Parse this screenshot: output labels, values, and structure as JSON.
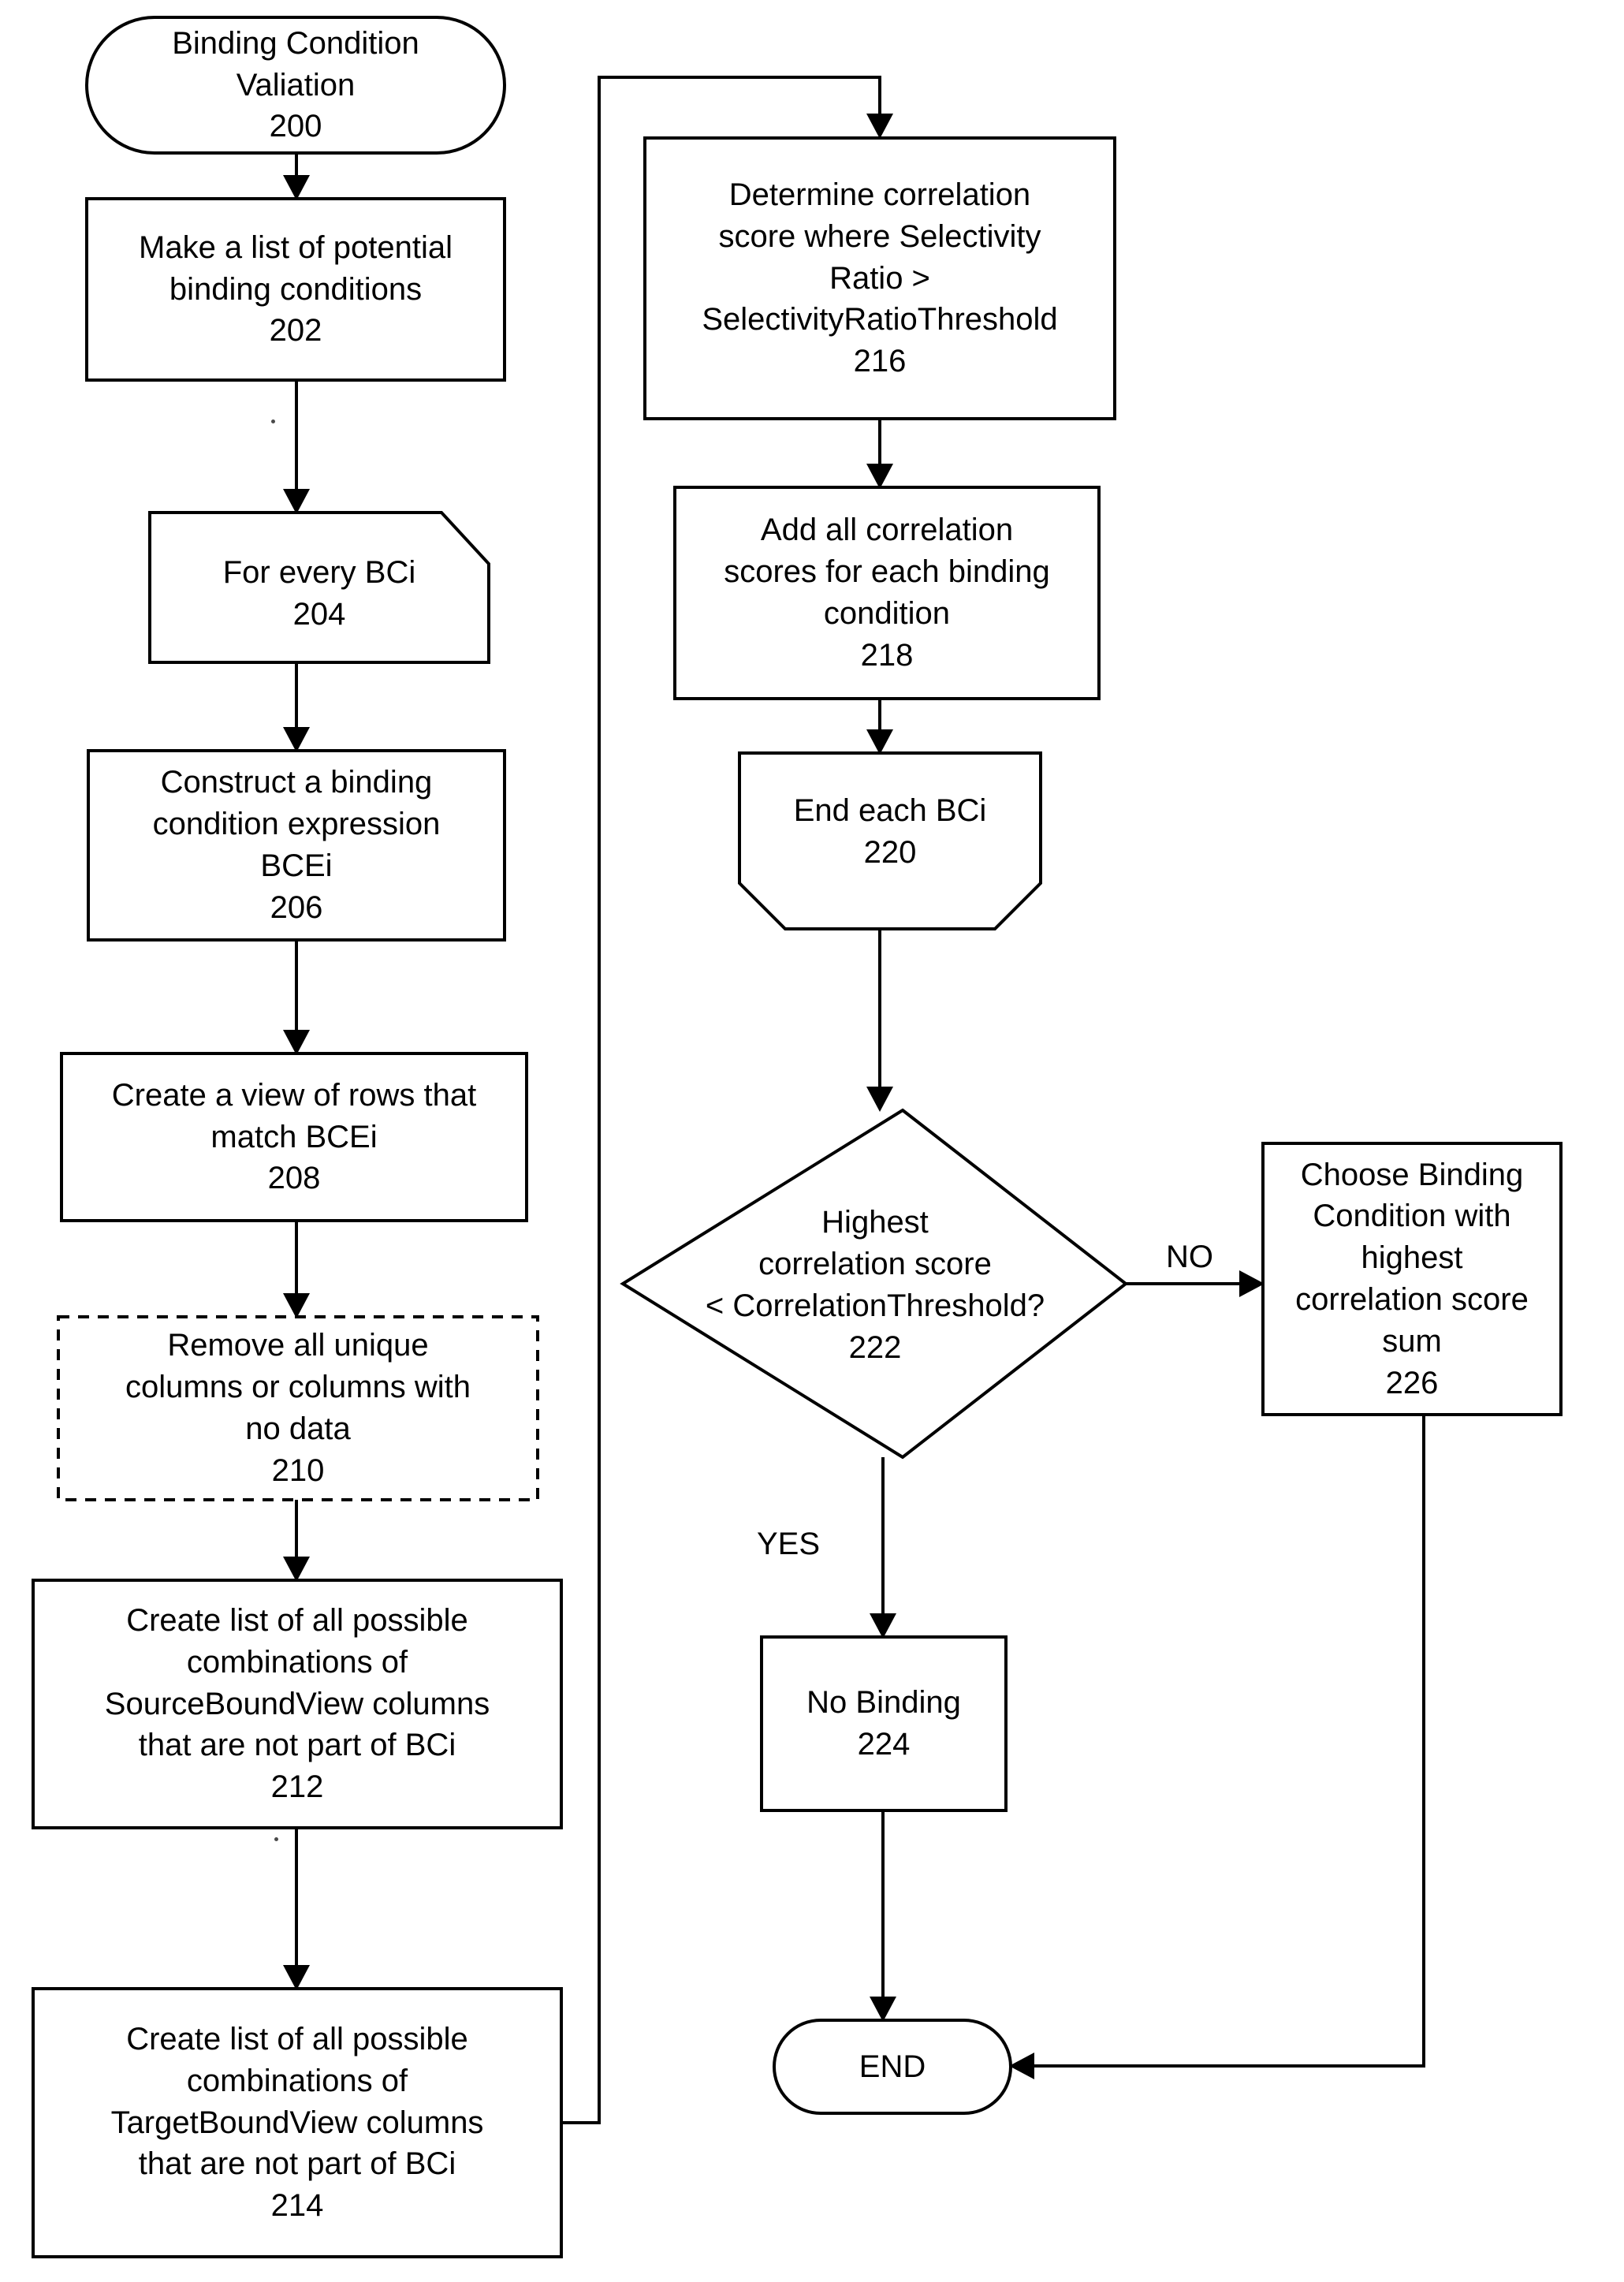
{
  "diagram": {
    "title": "Binding Condition Valiation flowchart",
    "stroke_color": "#000000",
    "fill_color": "#ffffff",
    "background": "#ffffff"
  },
  "nodes": {
    "n200": {
      "label": "Binding Condition\nValiation\n200",
      "ref": "200",
      "shape": "stadium"
    },
    "n202": {
      "label": "Make a list of potential\nbinding conditions\n202",
      "ref": "202",
      "shape": "rect"
    },
    "n204": {
      "label": "For every BCi\n204",
      "ref": "204",
      "shape": "loop-start"
    },
    "n206": {
      "label": "Construct a binding\ncondition expression\nBCEi\n206",
      "ref": "206",
      "shape": "rect"
    },
    "n208": {
      "label": "Create a view of rows that\nmatch  BCEi\n208",
      "ref": "208",
      "shape": "rect"
    },
    "n210": {
      "label": "Remove all unique\ncolumns or columns with\nno data\n210",
      "ref": "210",
      "shape": "rect-dashed"
    },
    "n212": {
      "label": "Create list of all possible\ncombinations of\nSourceBoundView columns\nthat are not part of BCi\n212",
      "ref": "212",
      "shape": "rect"
    },
    "n214": {
      "label": "Create list of all possible\ncombinations of\nTargetBoundView columns\nthat are not part of BCi\n214",
      "ref": "214",
      "shape": "rect"
    },
    "n216": {
      "label": "Determine correlation\nscore where Selectivity\nRatio >\nSelectivityRatioThreshold\n216",
      "ref": "216",
      "shape": "rect"
    },
    "n218": {
      "label": "Add all correlation\nscores for each binding\ncondition\n218",
      "ref": "218",
      "shape": "rect"
    },
    "n220": {
      "label": "End each BCi\n220",
      "ref": "220",
      "shape": "loop-end"
    },
    "n222": {
      "label": "Highest\ncorrelation score\n< CorrelationThreshold?\n222",
      "ref": "222",
      "shape": "diamond"
    },
    "n224": {
      "label": "No Binding\n224",
      "ref": "224",
      "shape": "rect"
    },
    "n226": {
      "label": "Choose Binding\nCondition with\nhighest\ncorrelation score\nsum\n226",
      "ref": "226",
      "shape": "rect"
    },
    "nend": {
      "label": "END",
      "ref": "",
      "shape": "stadium"
    }
  },
  "edge_labels": {
    "no": "NO",
    "yes": "YES"
  }
}
